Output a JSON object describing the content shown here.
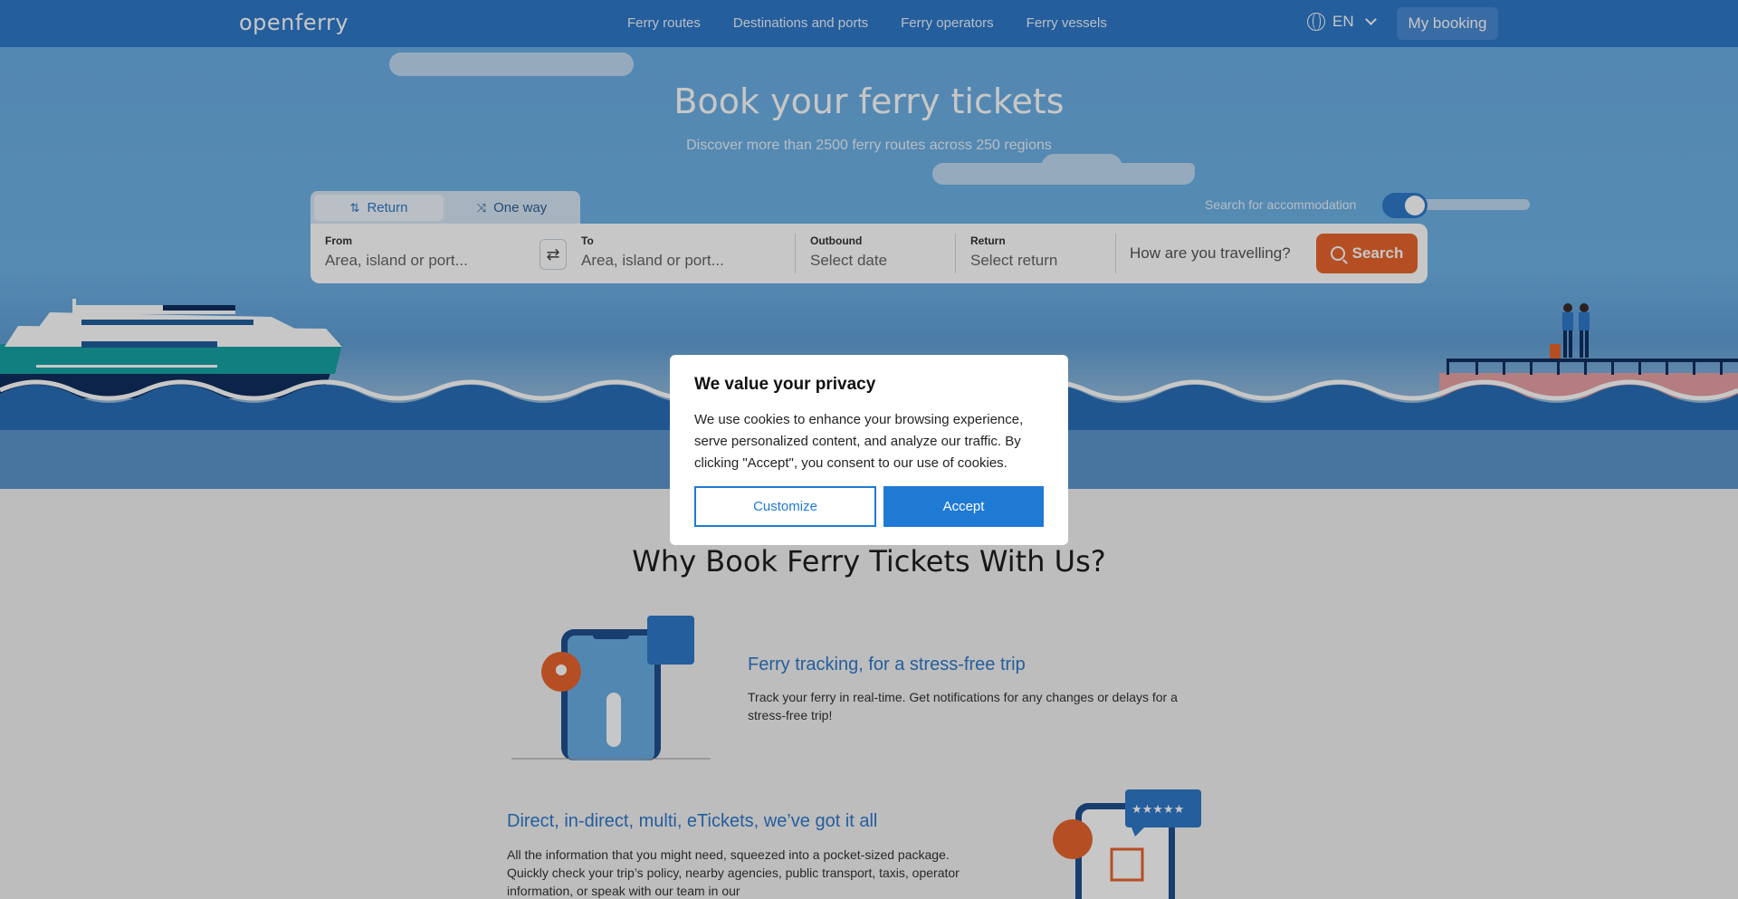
{
  "nav": {
    "logo": "openferry",
    "links": [
      "Ferry routes",
      "Destinations and ports",
      "Ferry operators",
      "Ferry vessels"
    ],
    "language": "EN",
    "my_booking": "My booking"
  },
  "hero": {
    "title": "Book your ferry tickets",
    "subtitle": "Discover more than 2500 ferry routes across 250 regions"
  },
  "search": {
    "tabs": [
      "Return",
      "One way"
    ],
    "active_tab": "Return",
    "accommodation_label": "Search for accommodation",
    "accommodation_on": true,
    "from_label": "From",
    "from_placeholder": "Area, island or port...",
    "to_label": "To",
    "to_placeholder": "Area, island or port...",
    "outbound_label": "Outbound",
    "outbound_placeholder": "Select date",
    "return_label": "Return",
    "return_placeholder": "Select return",
    "travelling_placeholder": "How are you travelling?",
    "search_button": "Search"
  },
  "why": {
    "title": "Why Book Ferry Tickets With Us?",
    "features": [
      {
        "title": "Ferry tracking, for a stress-free trip",
        "text": "Track your ferry in real-time. Get notifications for any changes or delays for a stress-free trip!"
      },
      {
        "title": "Direct, in-direct, multi, eTickets, we’ve got it all",
        "text": "All the information that you might need, squeezed into a pocket-sized package. Quickly check your trip’s policy, nearby agencies, public transport, taxis, operator information, or speak with our team in our"
      }
    ]
  },
  "cookie": {
    "title": "We value your privacy",
    "text": "We use cookies to enhance your browsing experience, serve personalized content, and analyze our traffic. By clicking \"Accept\", you consent to our use of cookies.",
    "customize": "Customize",
    "accept": "Accept"
  },
  "colors": {
    "brand": "#2f79c9",
    "accent": "#e8662e",
    "dialog_button": "#1f7ad4"
  }
}
